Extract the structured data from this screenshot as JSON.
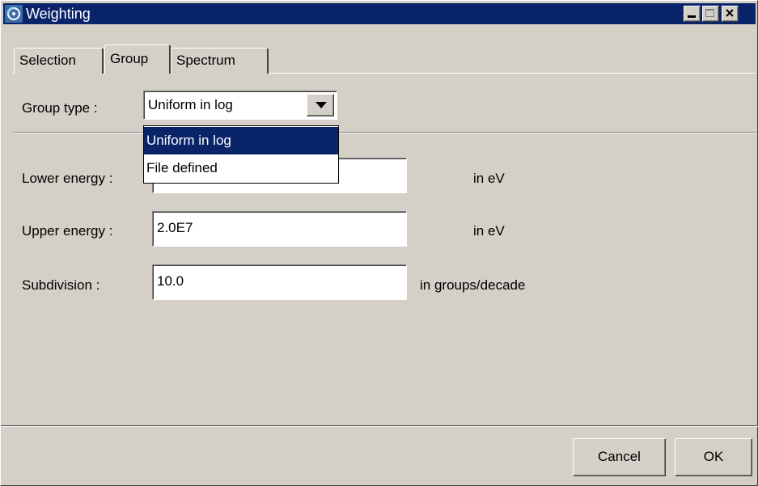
{
  "window": {
    "title": "Weighting",
    "titlebar_color": "#0a246a"
  },
  "tabs": [
    {
      "label": "Selection",
      "active": false
    },
    {
      "label": "Group",
      "active": true
    },
    {
      "label": "Spectrum",
      "active": false
    }
  ],
  "group_type": {
    "label": "Group type :",
    "value": "Uniform in log",
    "options": [
      "Uniform in log",
      "File defined"
    ],
    "highlighted_option": "Uniform in log"
  },
  "fields": {
    "lower_energy": {
      "label": "Lower energy :",
      "value": "",
      "unit": "in eV"
    },
    "upper_energy": {
      "label": "Upper energy :",
      "value": "2.0E7",
      "unit": "in eV"
    },
    "subdivision": {
      "label": "Subdivision :",
      "value": "10.0",
      "unit": "in groups/decade"
    }
  },
  "buttons": {
    "cancel": "Cancel",
    "ok": "OK"
  }
}
